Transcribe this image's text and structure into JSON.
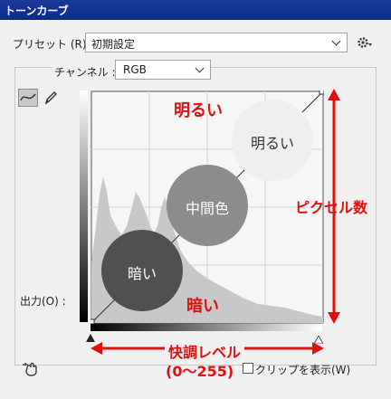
{
  "window": {
    "title": "トーンカーブ"
  },
  "preset": {
    "label": "プリセット (R) :",
    "value": "初期設定"
  },
  "channel": {
    "label": "チャンネル :",
    "value": "RGB"
  },
  "output_label": "出力(O) :",
  "clip_label": "クリップを表示(W)",
  "annotations": {
    "bright_top": "明るい",
    "bright_circle": "明るい",
    "midtone_circle": "中間色",
    "dark_circle": "暗い",
    "dark_bottom": "暗い",
    "pixel_count": "ピクセル数",
    "tone_level": "快調レベル",
    "tone_range": "(0〜255)"
  },
  "colors": {
    "annotation_red": "#e01010",
    "title_bar": "#0c2a8a",
    "bright_circle": "#efefef",
    "midtone_circle": "#8c8c8c",
    "dark_circle": "#505050"
  },
  "icons": {
    "gear": "gear-icon",
    "curve_tool": "curve-tool-icon",
    "pencil_tool": "pencil-icon",
    "hand_target": "target-adjust-icon"
  }
}
